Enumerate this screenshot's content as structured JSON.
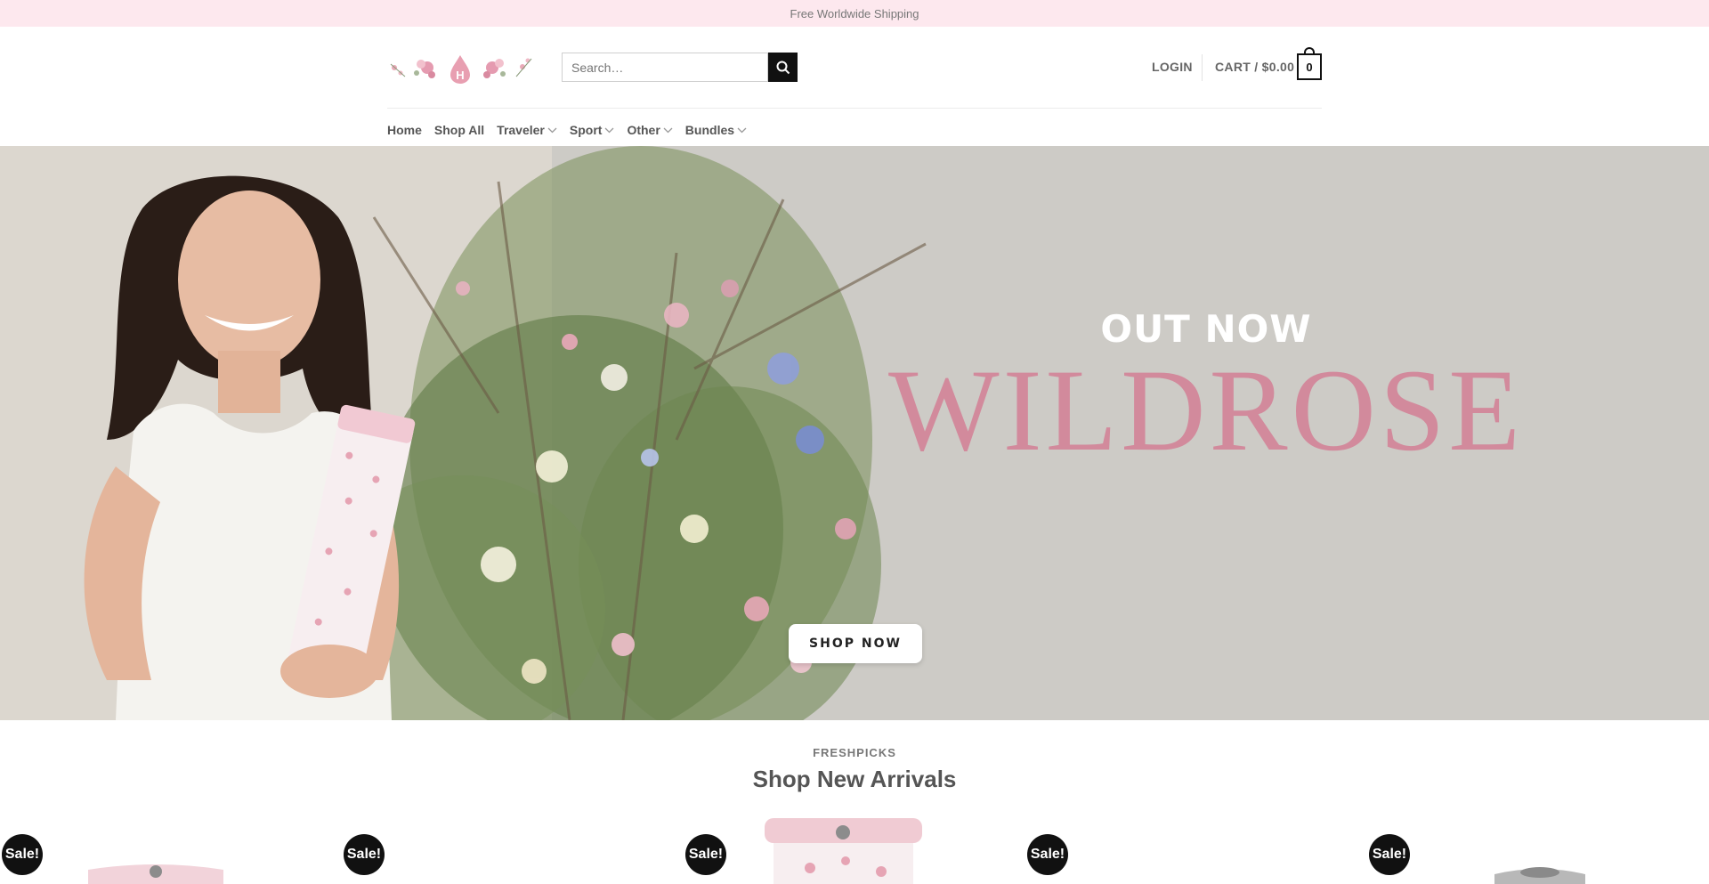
{
  "topbar": {
    "text": "Free Worldwide Shipping"
  },
  "header": {
    "search_placeholder": "Search…",
    "login": "LOGIN",
    "cart_label": "CART / $0.00",
    "cart_count": "0"
  },
  "nav": {
    "items": [
      {
        "label": "Home"
      },
      {
        "label": "Shop All"
      },
      {
        "label": "Traveler"
      },
      {
        "label": "Sport"
      },
      {
        "label": "Other"
      },
      {
        "label": "Bundles"
      }
    ]
  },
  "hero": {
    "kicker": "OUT NOW",
    "title": "WILDROSE",
    "cta": "SHOP NOW"
  },
  "section": {
    "kicker": "FRESHPICKS",
    "title": "Shop New Arrivals"
  },
  "products": {
    "badges": [
      "Sale!",
      "Sale!",
      "Sale!",
      "Sale!",
      "Sale!"
    ]
  },
  "colors": {
    "topbar_bg": "#fde8ee",
    "accent_pink": "#d28a9c",
    "badge_bg": "#111111"
  }
}
